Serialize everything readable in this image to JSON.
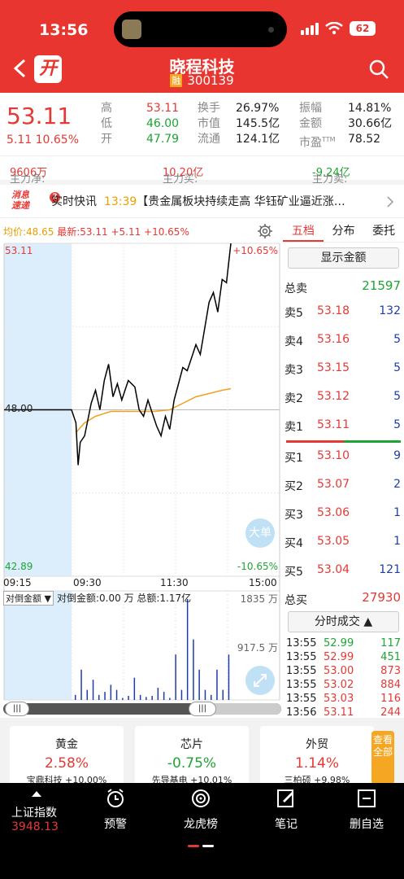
{
  "status": {
    "time": "13:56",
    "battery": "62"
  },
  "header": {
    "back_icon": "back-arrow",
    "brand": "开",
    "title": "晓程科技",
    "badge": "融",
    "code": "300139",
    "search_icon": "search"
  },
  "quote": {
    "price": "53.11",
    "change": "5.11",
    "change_pct": "10.65%",
    "col1_labels": [
      "高",
      "低",
      "开"
    ],
    "col1_values": [
      "53.11",
      "46.00",
      "47.79"
    ],
    "col2_labels": [
      "换手",
      "市值",
      "流通"
    ],
    "col2_values": [
      "26.97%",
      "145.5亿",
      "124.1亿"
    ],
    "col3_labels": [
      "振幅",
      "金额",
      "市盈"
    ],
    "col3_values": [
      "14.81%",
      "30.66亿",
      "78.52"
    ],
    "ttm": "TTM"
  },
  "flow": {
    "net_label": "主力净:",
    "net_value": "9606万",
    "buy_label": "主力买:",
    "buy_value": "10.20亿",
    "sell_label": "主力卖:",
    "sell_value": "-9.24亿"
  },
  "news": {
    "logo_top": "消息",
    "logo_bottom": "速递",
    "badge": "2",
    "label": "实时快讯",
    "time": "13:39",
    "text": "【贵金属板块持续走高 华钰矿业逼近涨…"
  },
  "chart": {
    "avg_label": "均价:48.65",
    "latest_label": "最新:53.11 +5.11 +10.65%",
    "top_price": "53.11",
    "top_pct": "+10.65%",
    "mid_price": "48.00",
    "bottom_price": "42.89",
    "bottom_pct": "-10.65%",
    "times": [
      "09:15",
      "09:30",
      "11:30",
      "15:00"
    ],
    "big_order_label": "大单",
    "vol_select": "对倒金额",
    "vol_text": "对倒金额:0.00 万 总额:1.17亿",
    "vol_max": "1835 万",
    "vol_mid": "917.5 万"
  },
  "chart_data": {
    "type": "line",
    "ylim": [
      42.89,
      53.11
    ],
    "series": [
      {
        "name": "最新",
        "color": "#000000",
        "points": [
          [
            0,
            48.0
          ],
          [
            0.27,
            48.0
          ],
          [
            0.29,
            47.6
          ],
          [
            0.3,
            46.3
          ],
          [
            0.31,
            47.0
          ],
          [
            0.33,
            47.2
          ],
          [
            0.36,
            48.2
          ],
          [
            0.38,
            48.6
          ],
          [
            0.4,
            48.0
          ],
          [
            0.42,
            48.9
          ],
          [
            0.44,
            49.4
          ],
          [
            0.46,
            48.4
          ],
          [
            0.48,
            48.8
          ],
          [
            0.5,
            48.3
          ],
          [
            0.53,
            48.9
          ],
          [
            0.56,
            48.7
          ],
          [
            0.58,
            48.0
          ],
          [
            0.6,
            47.8
          ],
          [
            0.62,
            48.3
          ],
          [
            0.64,
            47.9
          ],
          [
            0.66,
            47.5
          ],
          [
            0.68,
            47.2
          ],
          [
            0.7,
            47.8
          ],
          [
            0.72,
            47.4
          ],
          [
            0.74,
            48.3
          ],
          [
            0.76,
            48.8
          ],
          [
            0.78,
            49.3
          ],
          [
            0.8,
            49.2
          ],
          [
            0.82,
            49.6
          ],
          [
            0.84,
            50.0
          ],
          [
            0.86,
            49.7
          ],
          [
            0.88,
            50.5
          ],
          [
            0.9,
            51.3
          ],
          [
            0.92,
            51.6
          ],
          [
            0.94,
            51.0
          ],
          [
            0.96,
            52.0
          ],
          [
            0.98,
            51.9
          ],
          [
            1.0,
            53.11
          ]
        ]
      },
      {
        "name": "均价",
        "color": "#f0a020",
        "points": [
          [
            0.29,
            47.3
          ],
          [
            0.33,
            47.6
          ],
          [
            0.38,
            47.8
          ],
          [
            0.45,
            47.95
          ],
          [
            0.55,
            47.95
          ],
          [
            0.65,
            47.95
          ],
          [
            0.72,
            48.0
          ],
          [
            0.78,
            48.2
          ],
          [
            0.84,
            48.4
          ],
          [
            0.9,
            48.5
          ],
          [
            0.96,
            48.6
          ],
          [
            1.0,
            48.65
          ]
        ]
      }
    ],
    "volume_bars": [
      0.05,
      0.3,
      0.1,
      0.2,
      0.05,
      0.08,
      0.15,
      0.1,
      0.02,
      0.04,
      0.22,
      0.05,
      0.03,
      0.04,
      0.12,
      0.08,
      0.02,
      0.45,
      0.1,
      1.0,
      0.6,
      0.3,
      0.1,
      0.05,
      0.3,
      0.1,
      0.45
    ]
  },
  "orderbook": {
    "tabs": [
      "五档",
      "分布",
      "委托"
    ],
    "show_amount": "显示金额",
    "total_sell_label": "总卖",
    "total_sell": "21597",
    "asks": [
      {
        "label": "卖5",
        "price": "53.18",
        "vol": "132"
      },
      {
        "label": "卖4",
        "price": "53.16",
        "vol": "5"
      },
      {
        "label": "卖3",
        "price": "53.15",
        "vol": "5"
      },
      {
        "label": "卖2",
        "price": "53.12",
        "vol": "5"
      },
      {
        "label": "卖1",
        "price": "53.11",
        "vol": "5"
      }
    ],
    "bids": [
      {
        "label": "买1",
        "price": "53.10",
        "vol": "9"
      },
      {
        "label": "买2",
        "price": "53.07",
        "vol": "2"
      },
      {
        "label": "买3",
        "price": "53.06",
        "vol": "1"
      },
      {
        "label": "买4",
        "price": "53.05",
        "vol": "1"
      },
      {
        "label": "买5",
        "price": "53.04",
        "vol": "121"
      }
    ],
    "total_buy_label": "总买",
    "total_buy": "27930",
    "trades_btn": "分时成交 ▲",
    "trades": [
      {
        "time": "13:55",
        "price": "52.99",
        "vol": "117"
      },
      {
        "time": "13:55",
        "price": "52.99",
        "vol": "451"
      },
      {
        "time": "13:55",
        "price": "53.00",
        "vol": "873"
      },
      {
        "time": "13:55",
        "price": "53.02",
        "vol": "884"
      },
      {
        "time": "13:55",
        "price": "53.03",
        "vol": "116"
      },
      {
        "time": "13:56",
        "price": "53.11",
        "vol": "244"
      }
    ]
  },
  "cards": [
    {
      "title": "黄金",
      "value": "2.58%",
      "sub": "宝鼎科技 +10.00%"
    },
    {
      "title": "芯片",
      "value": "-0.75%",
      "sub": "先导基电 +10.01%"
    },
    {
      "title": "外贸",
      "value": "1.14%",
      "sub": "三柏硕 +9.98%"
    }
  ],
  "see_all": "查看全部",
  "bottom": {
    "index_name": "上证指数",
    "index_value": "3948.13",
    "items": [
      "预警",
      "龙虎榜",
      "笔记",
      "删自选"
    ]
  }
}
